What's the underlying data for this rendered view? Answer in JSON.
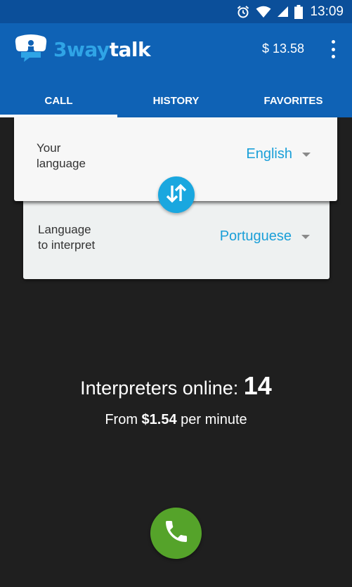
{
  "status_bar": {
    "time": "13:09",
    "icons": [
      "alarm-icon",
      "wifi-icon",
      "signal-icon",
      "battery-icon"
    ]
  },
  "app": {
    "logo_prefix": "3way",
    "logo_suffix": "talk",
    "balance": "$ 13.58"
  },
  "tabs": [
    {
      "label": "CALL",
      "active": true
    },
    {
      "label": "HISTORY",
      "active": false
    },
    {
      "label": "FAVORITES",
      "active": false
    }
  ],
  "your_language": {
    "label": "Your\nlanguage",
    "value": "English"
  },
  "interpret_language": {
    "label": "Language\nto interpret",
    "value": "Portuguese"
  },
  "info": {
    "online_label": "Interpreters online: ",
    "online_count": "14",
    "price_prefix": "From ",
    "price_value": "$1.54",
    "price_suffix": " per minute"
  },
  "colors": {
    "status_bar": "#0b4f9a",
    "app_bar": "#0f62b5",
    "accent": "#1aa7df",
    "call_green": "#55a32a",
    "background": "#1f1f1f"
  }
}
